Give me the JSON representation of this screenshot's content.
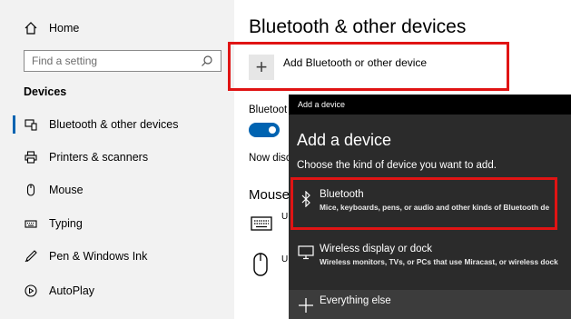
{
  "sidebar": {
    "home": "Home",
    "search_placeholder": "Find a setting",
    "section": "Devices",
    "items": [
      {
        "label": "Bluetooth & other devices",
        "icon": "bluetooth-devices-icon"
      },
      {
        "label": "Printers & scanners",
        "icon": "printer-icon"
      },
      {
        "label": "Mouse",
        "icon": "mouse-icon"
      },
      {
        "label": "Typing",
        "icon": "keyboard-icon"
      },
      {
        "label": "Pen & Windows Ink",
        "icon": "pen-icon"
      },
      {
        "label": "AutoPlay",
        "icon": "autoplay-icon"
      }
    ]
  },
  "main": {
    "title": "Bluetooth & other devices",
    "add_button": "Add Bluetooth or other device",
    "bluetooth_label": "Bluetoot",
    "now_discoverable": "Now disc",
    "mouse_heading": "Mouse",
    "u1": "U",
    "u2": "U"
  },
  "dialog": {
    "titlebar": "Add a device",
    "title": "Add a device",
    "subtitle": "Choose the kind of device you want to add.",
    "options": [
      {
        "title": "Bluetooth",
        "desc": "Mice, keyboards, pens, or audio and other kinds of Bluetooth de",
        "icon": "bluetooth-icon"
      },
      {
        "title": "Wireless display or dock",
        "desc": "Wireless monitors, TVs, or PCs that use Miracast, or wireless dock",
        "icon": "monitor-icon"
      },
      {
        "title": "Everything else",
        "desc": "",
        "icon": "plus-icon"
      }
    ]
  },
  "colors": {
    "accent": "#0063b1",
    "highlight": "#e01414",
    "dialog_bg": "#2b2b2b"
  }
}
